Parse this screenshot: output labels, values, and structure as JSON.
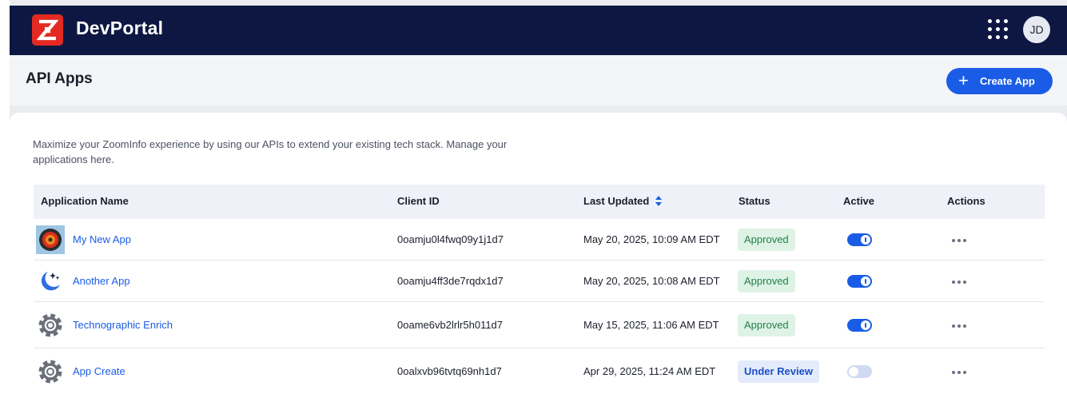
{
  "app": {
    "brand": "DevPortal",
    "user_initials": "JD"
  },
  "header": {
    "title": "API Apps",
    "create_label": "Create App",
    "create_icon": "plus-icon"
  },
  "description": "Maximize your ZoomInfo experience by using our APIs to extend your existing tech stack. Manage your applications here.",
  "table": {
    "columns": [
      "Application Name",
      "Client ID",
      "Last Updated",
      "Status",
      "Active",
      "Actions"
    ],
    "sorted_column": "Last Updated",
    "rows": [
      {
        "name": "My New App",
        "icon": "target-logo-icon",
        "client_id": "0oamju0l4fwq09y1j1d7",
        "updated": "May 20, 2025, 10:09 AM EDT",
        "status": "Approved",
        "active": true
      },
      {
        "name": "Another App",
        "icon": "moon-stars-logo-icon",
        "client_id": "0oamju4ff3de7rqdx1d7",
        "updated": "May 20, 2025, 10:08 AM EDT",
        "status": "Approved",
        "active": true
      },
      {
        "name": "Technographic Enrich",
        "icon": "gear-icon",
        "client_id": "0oame6vb2lrlr5h011d7",
        "updated": "May 15, 2025, 11:06 AM EDT",
        "status": "Approved",
        "active": true
      },
      {
        "name": "App Create",
        "icon": "gear-icon",
        "client_id": "0oalxvb96tvtq69nh1d7",
        "updated": "Apr 29, 2025, 11:24 AM EDT",
        "status": "Under Review",
        "active": false
      }
    ]
  },
  "colors": {
    "nav_bg": "#0d1742",
    "brand_red": "#e32a22",
    "accent_blue": "#1a5ce6",
    "approved_bg": "#def3e6",
    "approved_text": "#21804a",
    "review_bg": "#e4ebfb"
  }
}
